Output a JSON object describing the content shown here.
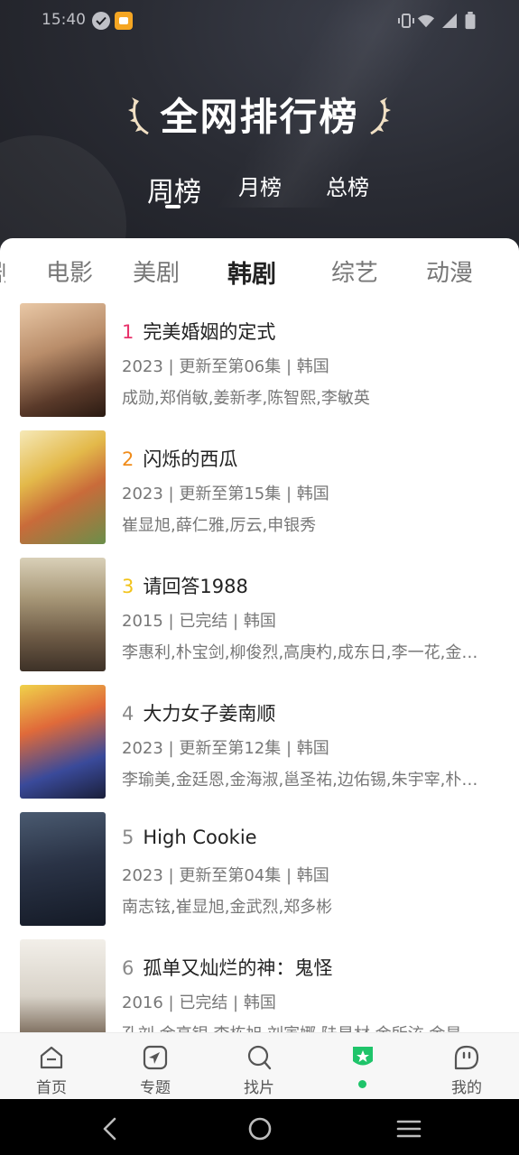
{
  "status_bar": {
    "time": "15:40"
  },
  "header": {
    "title": "全网排行榜",
    "period_tabs": [
      {
        "label": "周榜",
        "active": true
      },
      {
        "label": "月榜",
        "active": false
      },
      {
        "label": "总榜",
        "active": false
      }
    ]
  },
  "category_tabs": [
    {
      "label": "电影",
      "active": false
    },
    {
      "label": "美剧",
      "active": false
    },
    {
      "label": "韩剧",
      "active": true
    },
    {
      "label": "综艺",
      "active": false
    },
    {
      "label": "动漫",
      "active": false
    }
  ],
  "rank_colors": {
    "1": "#e8336b",
    "2": "#f08c1b",
    "3": "#f2c31b",
    "default": "#8a8a8a"
  },
  "items": [
    {
      "rank": "1",
      "title": "完美婚姻的定式",
      "meta": "2023 | 更新至第06集 | 韩国",
      "cast": "成勋,郑俏敏,姜新孝,陈智熙,李敏英"
    },
    {
      "rank": "2",
      "title": "闪烁的西瓜",
      "meta": "2023 | 更新至第15集 | 韩国",
      "cast": "崔显旭,薛仁雅,厉云,申银秀"
    },
    {
      "rank": "3",
      "title": "请回答1988",
      "meta": "2015 | 已完结 | 韩国",
      "cast": "李惠利,朴宝剑,柳俊烈,高庚杓,成东日,李一花,金善英,罗美兰"
    },
    {
      "rank": "4",
      "title": "大力女子姜南顺",
      "meta": "2023 | 更新至第12集 | 韩国",
      "cast": "李瑜美,金廷恩,金海淑,邕圣祐,边佑锡,朱宇宰,朴宝英"
    },
    {
      "rank": "5",
      "title": "High Cookie",
      "meta": "2023 | 更新至第04集 | 韩国",
      "cast": "南志铉,崔显旭,金武烈,郑多彬"
    },
    {
      "rank": "6",
      "title": "孤单又灿烂的神：鬼怪",
      "meta": "2016 | 已完结 | 韩国",
      "cast": "孔刘,金高银,李栋旭,刘寅娜,陆星材,金所泫,金昊"
    }
  ],
  "bottom_nav": [
    {
      "label": "首页",
      "icon": "home-icon"
    },
    {
      "label": "专题",
      "icon": "topic-compass-icon"
    },
    {
      "label": "找片",
      "icon": "search-icon"
    },
    {
      "label": "",
      "icon": "rank-badge-star-icon",
      "active": true
    },
    {
      "label": "我的",
      "icon": "profile-face-icon"
    }
  ]
}
